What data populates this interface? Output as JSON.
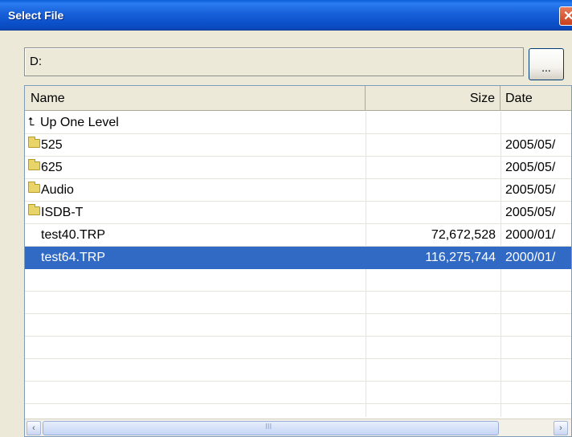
{
  "window": {
    "title": "Select File"
  },
  "path": {
    "value": "D:"
  },
  "browse": {
    "label": "..."
  },
  "columns": {
    "name": "Name",
    "size": "Size",
    "date": "Date"
  },
  "rows": [
    {
      "name": "Up One Level",
      "size": "",
      "date": "",
      "icon": "up-arrow-icon"
    },
    {
      "name": "525",
      "size": "",
      "date": "2005/05/",
      "icon": "folder-icon"
    },
    {
      "name": "625",
      "size": "",
      "date": "2005/05/",
      "icon": "folder-icon"
    },
    {
      "name": "Audio",
      "size": "",
      "date": "2005/05/",
      "icon": "folder-icon"
    },
    {
      "name": "ISDB-T",
      "size": "",
      "date": "2005/05/",
      "icon": "folder-icon"
    },
    {
      "name": "test40.TRP",
      "size": "72,672,528",
      "date": "2000/01/",
      "icon": ""
    },
    {
      "name": "test64.TRP",
      "size": "116,275,744",
      "date": "2000/01/",
      "icon": "",
      "selected": true
    }
  ],
  "scrollbar": {
    "thumb_grip": "III"
  },
  "colors": {
    "titlebar": "#0b4fc8",
    "selection": "#316ac5",
    "background": "#ece9d8"
  }
}
